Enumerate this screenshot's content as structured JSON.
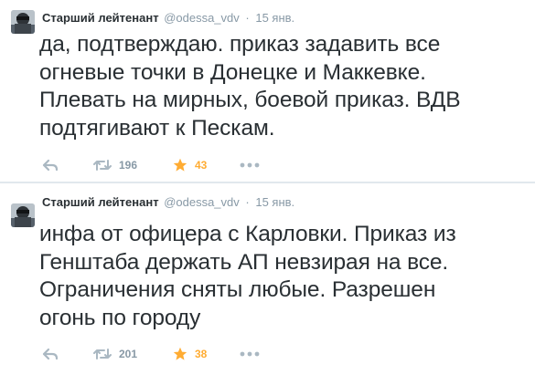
{
  "tweets": [
    {
      "name": "Старший лейтенант",
      "handle": "@odessa_vdv",
      "separator": "·",
      "date": "15 янв.",
      "text_lines": [
        "да, подтверждаю. приказ задавить все",
        "огневые точки в Донецке и Маккевке.",
        "Плевать на мирных, боевой приказ. ВДВ",
        "подтягивают к Пескам."
      ],
      "retweets": "196",
      "favorites": "43"
    },
    {
      "name": "Старший лейтенант",
      "handle": "@odessa_vdv",
      "separator": "·",
      "date": "15 янв.",
      "text_lines": [
        "инфа от офицера с Карловки. Приказ из",
        "Генштаба держать АП невзирая на все.",
        "Ограничения сняты любые. Разрешен",
        "огонь по городу"
      ],
      "retweets": "201",
      "favorites": "38"
    }
  ],
  "colors": {
    "text": "#292f33",
    "muted": "#8899a6",
    "favorite": "#ffac33",
    "divider": "#e1e8ed"
  }
}
